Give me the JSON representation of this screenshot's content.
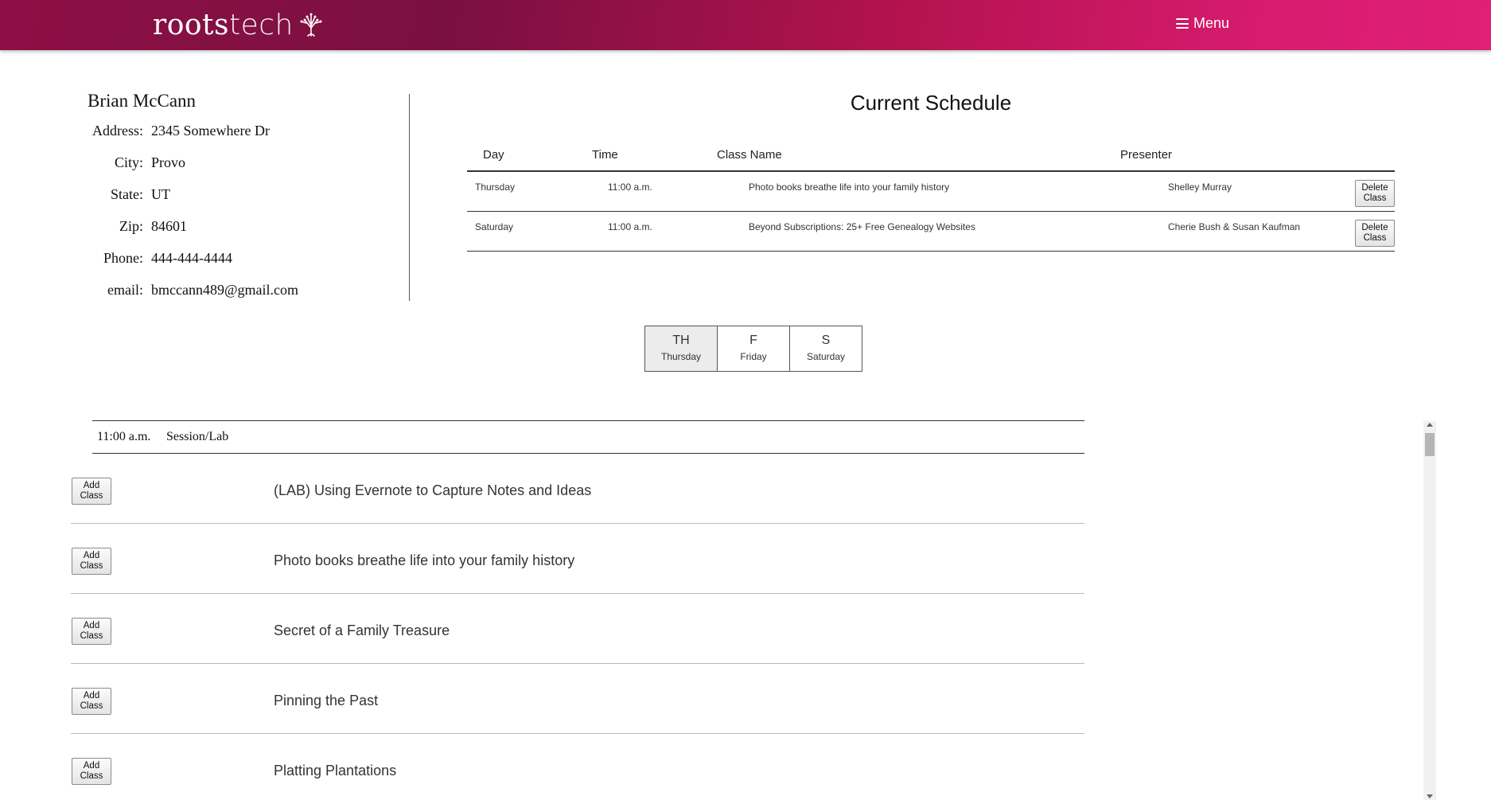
{
  "header": {
    "logo_roots": "roots",
    "logo_tech": "tech",
    "menu_label": "Menu"
  },
  "profile": {
    "name": "Brian McCann",
    "fields": [
      {
        "label": "Address:",
        "value": "2345 Somewhere Dr"
      },
      {
        "label": "City:",
        "value": "Provo"
      },
      {
        "label": "State:",
        "value": "UT"
      },
      {
        "label": "Zip:",
        "value": "84601"
      },
      {
        "label": "Phone:",
        "value": "444-444-4444"
      },
      {
        "label": "email:",
        "value": "bmccann489@gmail.com"
      }
    ]
  },
  "schedule": {
    "title": "Current Schedule",
    "headers": {
      "day": "Day",
      "time": "Time",
      "class_name": "Class Name",
      "presenter": "Presenter"
    },
    "rows": [
      {
        "day": "Thursday",
        "time": "11:00 a.m.",
        "class_name": "Photo books breathe life into your family history",
        "presenter": "Shelley Murray",
        "button": "Delete Class"
      },
      {
        "day": "Saturday",
        "time": "11:00 a.m.",
        "class_name": "Beyond Subscriptions: 25+ Free Genealogy Websites",
        "presenter": "Cherie Bush & Susan Kaufman",
        "button": "Delete Class"
      }
    ]
  },
  "day_tabs": [
    {
      "abbr": "TH",
      "full": "Thursday",
      "active": true
    },
    {
      "abbr": "F",
      "full": "Friday",
      "active": false
    },
    {
      "abbr": "S",
      "full": "Saturday",
      "active": false
    }
  ],
  "session_header": {
    "time": "11:00 a.m.",
    "type": "Session/Lab"
  },
  "sessions": [
    {
      "name": "(LAB) Using Evernote to Capture Notes and Ideas",
      "button": "Add Class"
    },
    {
      "name": "Photo books breathe life into your family history",
      "button": "Add Class"
    },
    {
      "name": "Secret of a Family Treasure",
      "button": "Add Class"
    },
    {
      "name": "Pinning the Past",
      "button": "Add Class"
    },
    {
      "name": "Platting Plantations",
      "button": "Add Class"
    }
  ]
}
